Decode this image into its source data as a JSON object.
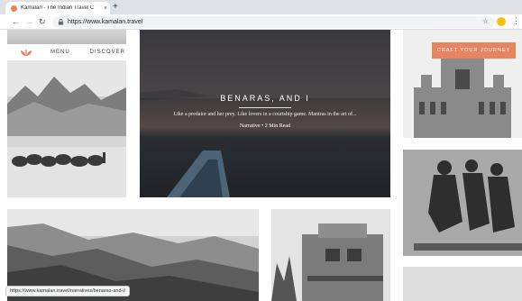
{
  "browser": {
    "tab_title": "Kamalan - The Indian Travel C",
    "tab_close": "×",
    "new_tab": "+",
    "back": "←",
    "forward": "→",
    "reload": "↻",
    "url": "https://www.kamalan.travel",
    "bookmark_star": "☆",
    "menu": "⋮"
  },
  "site": {
    "nav": {
      "menu_label": "MENU",
      "discover_label": "DISCOVER"
    },
    "cta_label": "CRAFT YOUR JOURNEY",
    "hero": {
      "title": "BENARAS, AND I",
      "excerpt": "Like a predator and her prey. Like lovers in a courtship game. Mantras in the art of...",
      "meta": "Narrative • 2 Min Read"
    }
  },
  "status_bar": {
    "url": "https://www.kamalan.travel/narratives/benaras-and-i/"
  },
  "colors": {
    "accent": "#e8845f"
  }
}
